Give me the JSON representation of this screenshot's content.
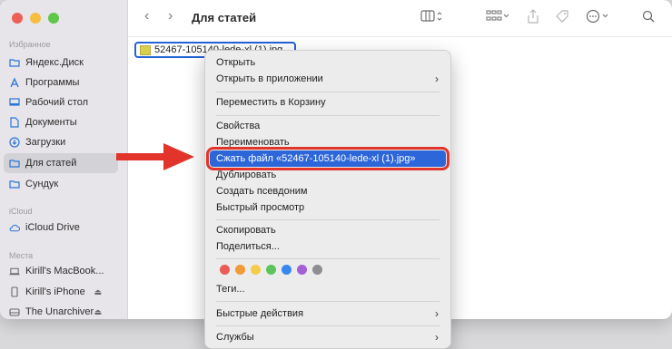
{
  "window": {
    "folder_title": "Для статей"
  },
  "sidebar": {
    "favorites_title": "Избранное",
    "favorites": [
      {
        "label": "Яндекс.Диск",
        "icon": "folder-icon"
      },
      {
        "label": "Программы",
        "icon": "apps-icon"
      },
      {
        "label": "Рабочий стол",
        "icon": "desktop-icon"
      },
      {
        "label": "Документы",
        "icon": "document-icon"
      },
      {
        "label": "Загрузки",
        "icon": "download-icon"
      },
      {
        "label": "Для статей",
        "icon": "folder-icon",
        "active": true
      },
      {
        "label": "Сундук",
        "icon": "folder-icon"
      }
    ],
    "icloud_title": "iCloud",
    "icloud": [
      {
        "label": "iCloud Drive",
        "icon": "cloud-icon"
      }
    ],
    "places_title": "Места",
    "places": [
      {
        "label": "Kirill's MacBook...",
        "icon": "laptop-icon"
      },
      {
        "label": "Kirill's iPhone",
        "icon": "phone-icon"
      },
      {
        "label": "The Unarchiver",
        "icon": "disk-icon"
      }
    ]
  },
  "file": {
    "name": "52467-105140-lede-xl (1).jpg"
  },
  "context_menu": {
    "open": "Открыть",
    "open_with": "Открыть в приложении",
    "move_to_trash": "Переместить в Корзину",
    "get_info": "Свойства",
    "rename": "Переименовать",
    "compress": "Сжать файл «52467-105140-lede-xl (1).jpg»",
    "duplicate": "Дублировать",
    "make_alias": "Создать псевдоним",
    "quick_look": "Быстрый просмотр",
    "copy": "Скопировать",
    "share": "Поделиться...",
    "tags": "Теги...",
    "quick_actions": "Быстрые действия",
    "services": "Службы",
    "tag_colors": [
      "#ec5b56",
      "#f29a38",
      "#f4cc49",
      "#5cc45a",
      "#3a86f0",
      "#a35fd6",
      "#8e8e92"
    ]
  },
  "colors": {
    "highlight": "#2c66d9",
    "annotation": "#e2342a"
  }
}
